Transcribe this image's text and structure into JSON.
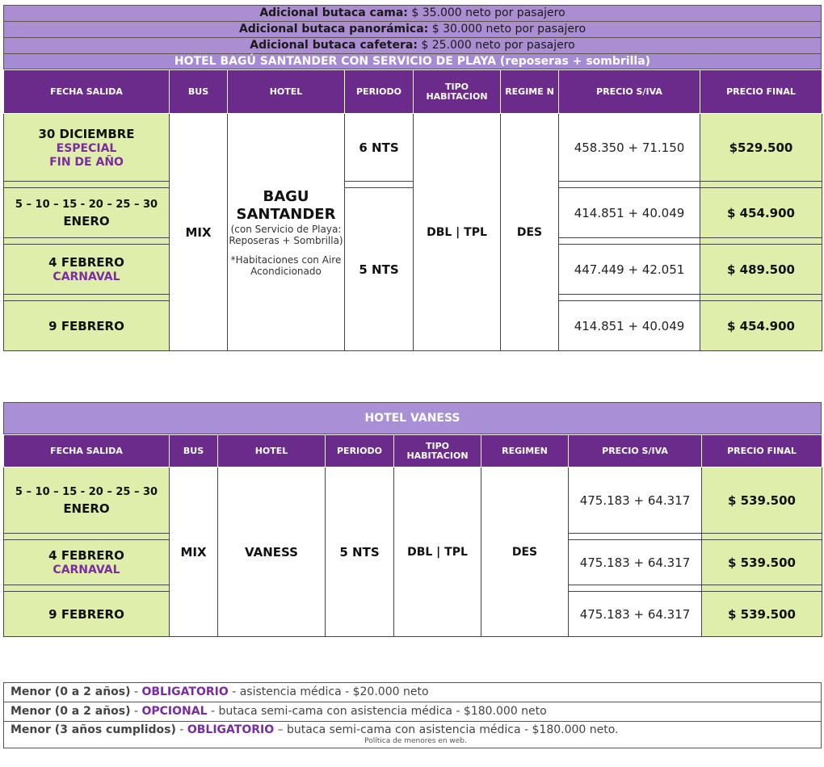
{
  "extras": [
    {
      "label": "Adicional butaca cama:",
      "value": "$ 35.000 neto por pasajero"
    },
    {
      "label": "Adicional butaca panorámica:",
      "value": "$ 30.000 neto por pasajero"
    },
    {
      "label": "Adicional butaca cafetera:",
      "value": "$ 25.000 neto por pasajero"
    }
  ],
  "colors": {
    "header_purple": "#6a2b8a",
    "banner_lilac": "#a58bd3",
    "highlight_green": "#e0eeab",
    "accent_purple": "#7a2ca0"
  },
  "table1": {
    "title": "HOTEL BAGÚ SANTANDER CON SERVICIO DE PLAYA (reposeras + sombrilla)",
    "headers": [
      "FECHA SALIDA",
      "BUS",
      "HOTEL",
      "PERIODO",
      "TIPO HABITACION",
      "REGIME N",
      "PRECIO S/IVA",
      "PRECIO FINAL"
    ],
    "bus": "MIX",
    "hotel_name": "BAGU SANTANDER",
    "hotel_desc": "(con Servicio de Playa: Reposeras + Sombrilla)",
    "hotel_note": "*Habitaciones con Aire Acondicionado",
    "tipo": "DBL | TPL",
    "regimen": "DES",
    "periodo_a": "6 NTS",
    "periodo_b": "5 NTS",
    "rows": [
      {
        "date": "30 DICIEMBRE",
        "sub": "ESPECIAL",
        "sub2": "FIN DE AÑO",
        "precio": "458.350 + 71.150",
        "final": "$529.500"
      },
      {
        "date_small": "5 – 10 – 15 - 20 – 25 – 30",
        "date": "ENERO",
        "precio": "414.851 + 40.049",
        "final": "$ 454.900"
      },
      {
        "date": "4 FEBRERO",
        "sub": "CARNAVAL",
        "precio": "447.449 + 42.051",
        "final": "$ 489.500"
      },
      {
        "date": "9 FEBRERO",
        "precio": "414.851 + 40.049",
        "final": "$ 454.900"
      }
    ]
  },
  "table2": {
    "title": "HOTEL VANESS",
    "headers": [
      "FECHA SALIDA",
      "BUS",
      "HOTEL",
      "PERIODO",
      "TIPO HABITACION",
      "REGIMEN",
      "PRECIO S/IVA",
      "PRECIO FINAL"
    ],
    "bus": "MIX",
    "hotel": "VANESS",
    "periodo": "5 NTS",
    "tipo": "DBL | TPL",
    "regimen": "DES",
    "rows": [
      {
        "date_small": "5 – 10 – 15 - 20 – 25 – 30",
        "date": "ENERO",
        "precio": "475.183 + 64.317",
        "final": "$ 539.500"
      },
      {
        "date": "4 FEBRERO",
        "sub": "CARNAVAL",
        "precio": "475.183 + 64.317",
        "final": "$ 539.500"
      },
      {
        "date": "9 FEBRERO",
        "precio": "475.183 + 64.317",
        "final": "$ 539.500"
      }
    ]
  },
  "notes": [
    {
      "bold": "Menor (0 a 2 años)",
      "sep": " - ",
      "flag": "OBLIGATORIO",
      "rest": " - asistencia médica - $20.000 neto"
    },
    {
      "bold": "Menor (0 a 2 años)",
      "sep": " - ",
      "flag": "OPCIONAL",
      "rest": " - butaca semi-cama con asistencia médica - $180.000 neto"
    },
    {
      "bold": "Menor (3 años cumplidos)",
      "sep": " - ",
      "flag": "OBLIGATORIO",
      "rest": " – butaca semi-cama con asistencia médica - $180.000 neto."
    }
  ],
  "web_note": "Política de menores en web."
}
